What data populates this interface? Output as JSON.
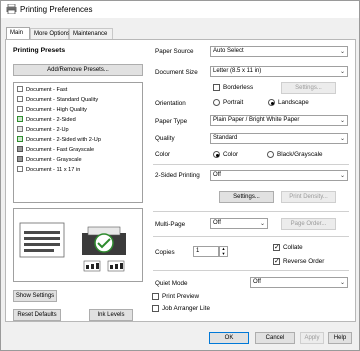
{
  "window": {
    "title": "Printing Preferences"
  },
  "tabs": [
    {
      "label": "Main"
    },
    {
      "label": "More Options"
    },
    {
      "label": "Maintenance"
    }
  ],
  "left": {
    "heading": "Printing Presets",
    "add_remove": "Add/Remove Presets...",
    "presets": [
      "Document - Fast",
      "Document - Standard Quality",
      "Document - High Quality",
      "Document - 2-Sided",
      "Document - 2-Up",
      "Document - 2-Sided with 2-Up",
      "Document - Fast Grayscale",
      "Document - Grayscale",
      "Document - 11 x 17 in"
    ],
    "show_settings": "Show Settings",
    "reset_defaults": "Reset Defaults",
    "ink_levels": "Ink Levels"
  },
  "form": {
    "paper_source": {
      "label": "Paper Source",
      "value": "Auto Select"
    },
    "document_size": {
      "label": "Document Size",
      "value": "Letter (8.5 x 11 in)"
    },
    "borderless": "Borderless",
    "settings_btn": "Settings...",
    "orientation": {
      "label": "Orientation",
      "portrait": "Portrait",
      "landscape": "Landscape",
      "selected": "Landscape"
    },
    "paper_type": {
      "label": "Paper Type",
      "value": "Plain Paper / Bright White Paper"
    },
    "quality": {
      "label": "Quality",
      "value": "Standard"
    },
    "color": {
      "label": "Color",
      "color": "Color",
      "grayscale": "Black/Grayscale",
      "selected": "Color"
    },
    "two_sided": {
      "label": "2-Sided Printing",
      "value": "Off"
    },
    "settings2": "Settings...",
    "print_density": "Print Density...",
    "multipage": {
      "label": "Multi-Page",
      "value": "Off"
    },
    "page_order": "Page Order...",
    "copies": {
      "label": "Copies",
      "value": "1"
    },
    "collate": "Collate",
    "reverse_order": "Reverse Order",
    "quiet_mode": {
      "label": "Quiet Mode",
      "value": "Off"
    },
    "print_preview": "Print Preview",
    "job_arranger": "Job Arranger Lite"
  },
  "footer": {
    "ok": "OK",
    "cancel": "Cancel",
    "apply": "Apply",
    "help": "Help"
  },
  "colors": {
    "accent": "#0078d7",
    "window_bg": "#f0f0f0",
    "panel_bg": "#ffffff"
  }
}
